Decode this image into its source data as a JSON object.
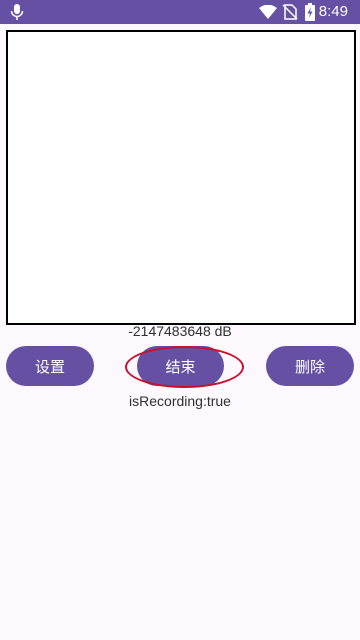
{
  "status_bar": {
    "time": "8:49",
    "icons": [
      "microphone-icon",
      "wifi-icon",
      "no-sim-icon",
      "battery-charging-icon"
    ]
  },
  "main": {
    "db_readout": "-2147483648 dB",
    "recording_status": "isRecording:true"
  },
  "buttons": {
    "settings_label": "设置",
    "stop_label": "结束",
    "delete_label": "删除"
  },
  "colors": {
    "primary": "#6650a4",
    "background": "#fdf8fd",
    "highlight": "#c8102e"
  }
}
